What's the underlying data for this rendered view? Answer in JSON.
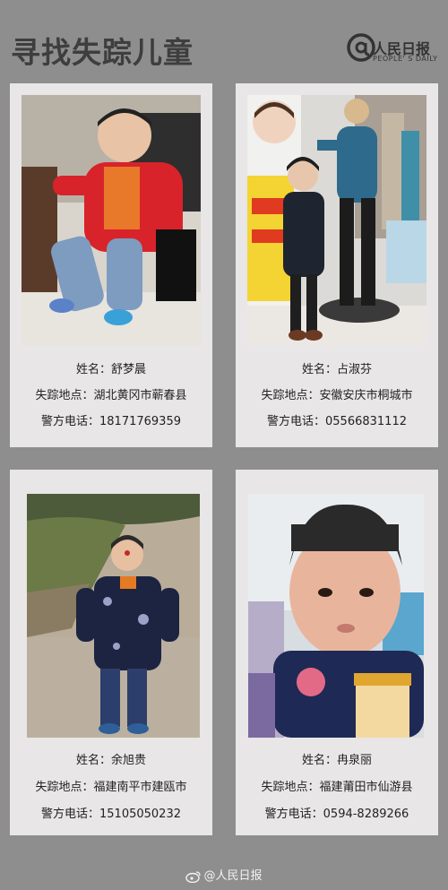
{
  "header": {
    "title": "寻找失踪儿童",
    "logo_name": "人民日报",
    "logo_sub": "PEOPLE' S DAILY"
  },
  "cards": [
    {
      "name": "姓名：舒梦晨",
      "location": "失踪地点：湖北黄冈市蕲春县",
      "phone": "警方电话：18171769359"
    },
    {
      "name": "姓名：占淑芬",
      "location": "失踪地点：安徽安庆市桐城市",
      "phone": "警方电话：05566831112"
    },
    {
      "name": "姓名：余旭贵",
      "location": "失踪地点：福建南平市建瓯市",
      "phone": "警方电话：15105050232"
    },
    {
      "name": "姓名：冉泉丽",
      "location": "失踪地点：福建莆田市仙游县",
      "phone": "警方电话：0594-8289266"
    }
  ],
  "watermark": "@人民日报",
  "colors": {
    "background": "#8e8e8e",
    "card": "#e8e6e6",
    "title": "#3e3e3e"
  }
}
